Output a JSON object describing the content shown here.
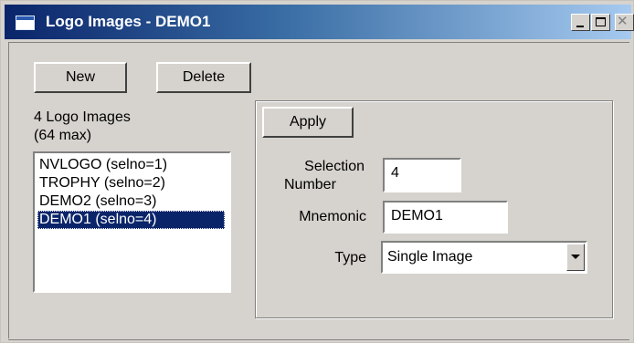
{
  "window": {
    "title": "Logo Images - DEMO1",
    "controls": {
      "minimize_icon": "minimize-icon",
      "maximize_icon": "maximize-icon",
      "close_icon": "close-icon",
      "close_glyph": "✕"
    }
  },
  "toolbar": {
    "new_label": "New",
    "delete_label": "Delete"
  },
  "logo_list": {
    "count_label": "4 Logo Images",
    "max_label": "(64 max)",
    "items": [
      {
        "label": "NVLOGO (selno=1)",
        "selected": false
      },
      {
        "label": "TROPHY (selno=2)",
        "selected": false
      },
      {
        "label": "DEMO2 (selno=3)",
        "selected": false
      },
      {
        "label": "DEMO1 (selno=4)",
        "selected": true
      }
    ]
  },
  "details": {
    "apply_label": "Apply",
    "selection_number_label_line1": "Selection",
    "selection_number_label_line2": "Number",
    "selection_number_value": "4",
    "mnemonic_label": "Mnemonic",
    "mnemonic_value": "DEMO1",
    "type_label": "Type",
    "type_value": "Single Image"
  },
  "colors": {
    "title_gradient_start": "#0a246a",
    "title_gradient_end": "#a6caf0",
    "window_face": "#d6d3ce",
    "selection": "#0a246a"
  }
}
